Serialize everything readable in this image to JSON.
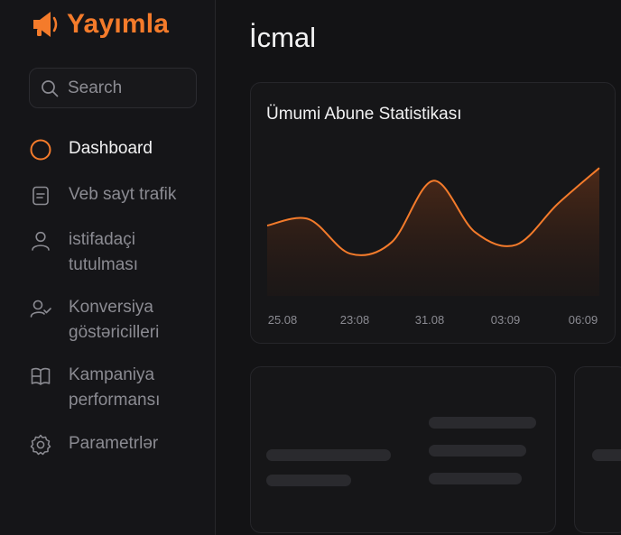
{
  "app": {
    "brand": "Yayımla",
    "accent_color": "#f47b2b",
    "brand_icon": "megaphone-icon"
  },
  "search": {
    "placeholder": "Search",
    "value": ""
  },
  "sidebar": {
    "items": [
      {
        "label": "Dashboard",
        "icon": "circle-icon",
        "active": true
      },
      {
        "label": "Veb sayt trafik",
        "icon": "document-icon",
        "active": false
      },
      {
        "label": "istifadaçi\ntutulması",
        "icon": "user-icon",
        "active": false
      },
      {
        "label": "Konversiya\ngöstəricilleri",
        "icon": "user-check-icon",
        "active": false
      },
      {
        "label": "Kampaniya\nperformansı",
        "icon": "book-icon",
        "active": false
      },
      {
        "label": "Parametrlər",
        "icon": "gear-icon",
        "active": false
      }
    ]
  },
  "main": {
    "page_title": "İcmal"
  },
  "chart_card": {
    "title": "Ümumi Abune Statistikası",
    "x_ticks": [
      "25.08",
      "23:08",
      "31.08",
      "03:09",
      "06:09"
    ]
  },
  "chart_data": {
    "type": "area",
    "title": "Ümumi Abune Statistikası",
    "xlabel": "",
    "ylabel": "",
    "x": [
      "25.08",
      "23:08",
      "31.08",
      "03:09",
      "06:09"
    ],
    "series": [
      {
        "values": [
          0.55,
          0.6,
          0.33,
          0.42,
          0.9,
          0.5,
          0.4,
          0.72,
          1.0
        ]
      }
    ],
    "x_positions": [
      0,
      0.125,
      0.25,
      0.375,
      0.5,
      0.625,
      0.75,
      0.875,
      1.0
    ],
    "ylim": [
      0,
      1.1
    ],
    "grid": false,
    "color": "#f47b2b"
  }
}
